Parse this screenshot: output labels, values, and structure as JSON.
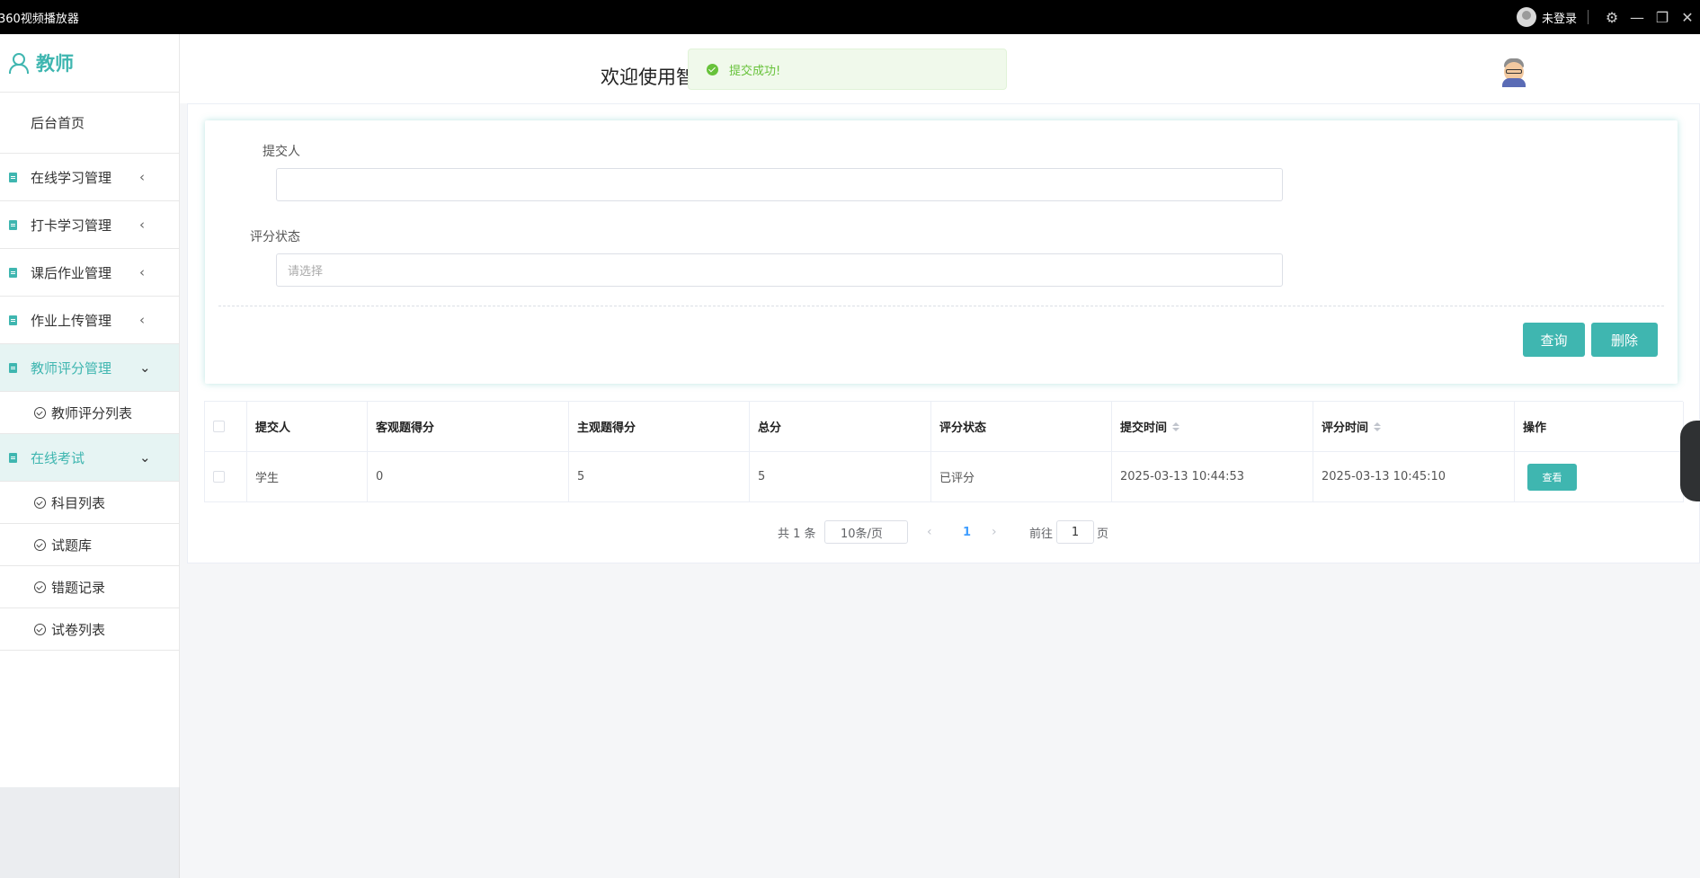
{
  "window": {
    "title": "360视频播放器",
    "user_status": "未登录"
  },
  "sidebar": {
    "brand": "教师",
    "home": "后台首页",
    "menus": [
      {
        "label": "在线学习管理",
        "arrow": "‹"
      },
      {
        "label": "打卡学习管理",
        "arrow": "‹"
      },
      {
        "label": "课后作业管理",
        "arrow": "‹"
      },
      {
        "label": "作业上传管理",
        "arrow": "‹"
      },
      {
        "label": "教师评分管理",
        "arrow": "⌄"
      },
      {
        "label": "在线考试",
        "arrow": "⌄"
      }
    ],
    "teacher_sub": [
      {
        "label": "教师评分列表"
      }
    ],
    "exam_sub": [
      {
        "label": "科目列表"
      },
      {
        "label": "试题库"
      },
      {
        "label": "错题记录"
      },
      {
        "label": "试卷列表"
      }
    ]
  },
  "header": {
    "welcome": "欢迎使用智"
  },
  "toast": {
    "message": "提交成功!"
  },
  "search": {
    "submitter_label": "提交人",
    "submitter_value": "",
    "status_label": "评分状态",
    "status_placeholder": "请选择",
    "query_button": "查询",
    "delete_button": "删除"
  },
  "table": {
    "columns": [
      "提交人",
      "客观题得分",
      "主观题得分",
      "总分",
      "评分状态",
      "提交时间",
      "评分时间",
      "操作"
    ],
    "rows": [
      {
        "submitter": "学生",
        "objective_score": "0",
        "subjective_score": "5",
        "total": "5",
        "status": "已评分",
        "submit_time": "2025-03-13 10:44:53",
        "score_time": "2025-03-13 10:45:10",
        "action": "查看"
      }
    ]
  },
  "pagination": {
    "total": "共 1 条",
    "page_size": "10条/页",
    "prev": "‹",
    "current": "1",
    "next": "›",
    "goto_label": "前往",
    "goto_value": "1",
    "unit": "页"
  }
}
